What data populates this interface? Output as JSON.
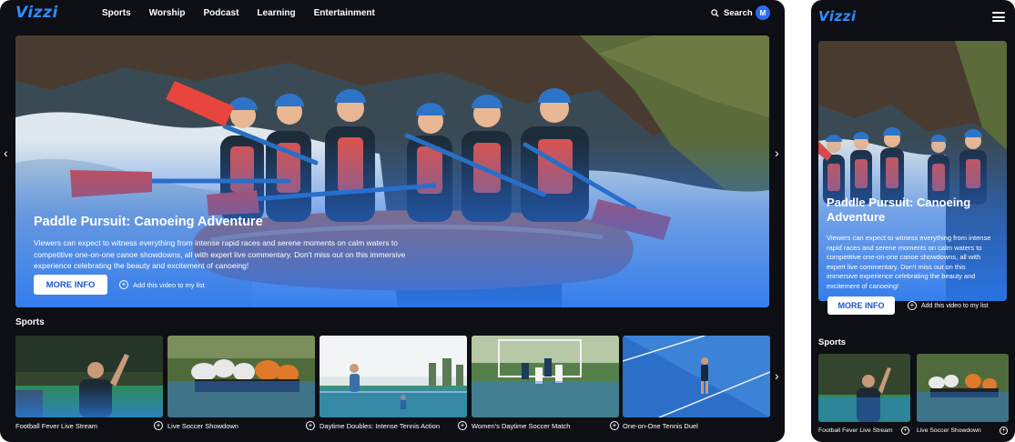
{
  "brand": {
    "logo_text": "Vizzi",
    "accent": "#2f8cff"
  },
  "nav": {
    "items": [
      {
        "label": "Sports"
      },
      {
        "label": "Worship"
      },
      {
        "label": "Podcast"
      },
      {
        "label": "Learning"
      },
      {
        "label": "Entertainment"
      }
    ],
    "search_label": "Search",
    "search_icon": "search-icon",
    "avatar_initial": "M"
  },
  "hero": {
    "title": "Paddle Pursuit: Canoeing Adventure",
    "description": "Viewers can expect to witness everything from intense rapid races and serene moments on calm waters to competitive one-on-one canoe showdowns, all with expert live commentary. Don't miss out on this immersive experience celebrating the beauty and excitement of canoeing!",
    "more_info_label": "MORE INFO",
    "add_list_label": "Add this video to my list"
  },
  "sports": {
    "section_title": "Sports",
    "cards": [
      {
        "title": "Football Fever Live Stream"
      },
      {
        "title": "Live Soccer Showdown"
      },
      {
        "title": "Daytime Doubles: Intense Tennis Action"
      },
      {
        "title": "Women's Daytime Soccer Match"
      },
      {
        "title": "One-on-One Tennis Duel"
      }
    ]
  },
  "icons": {
    "prev": "chevron-left-icon",
    "next": "chevron-right-icon",
    "menu": "hamburger-menu-icon",
    "add": "plus-circle-icon"
  }
}
